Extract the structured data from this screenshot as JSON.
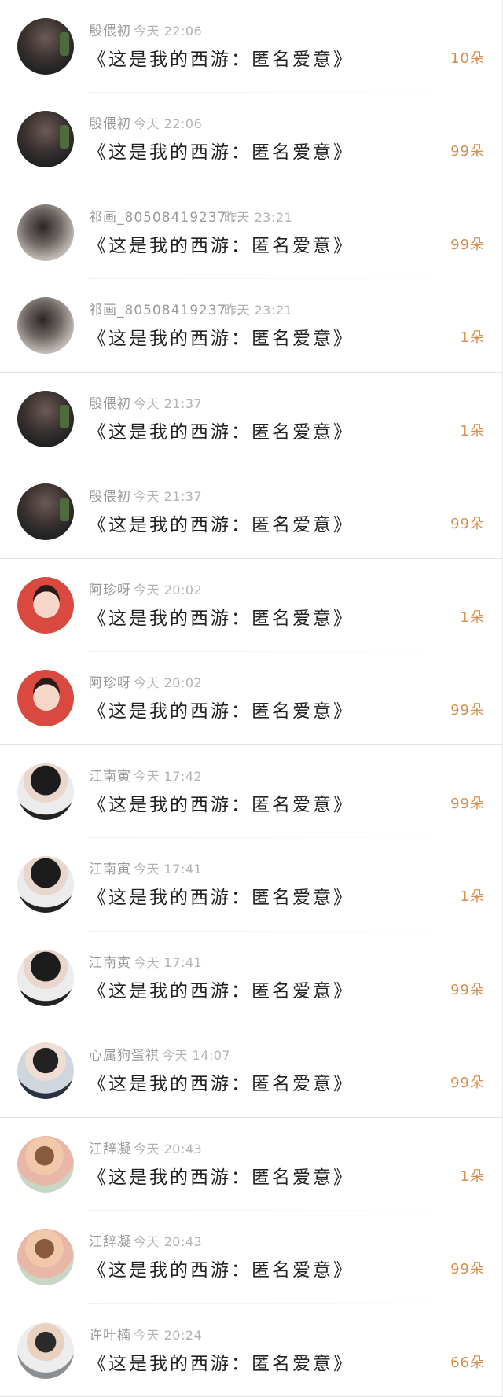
{
  "messages": [
    {
      "name": "殷偎初",
      "time": "今天 22:06",
      "title": "《这是我的西游：匿名爱意》",
      "count": "10朵",
      "avatar": "dark-avatar"
    },
    {
      "name": "殷偎初",
      "time": "今天 22:06",
      "title": "《这是我的西游：匿名爱意》",
      "count": "99朵",
      "avatar": "dark-avatar"
    },
    {
      "name": "祁画_80508419237...",
      "time": "昨天 23:21",
      "title": "《这是我的西游：匿名爱意》",
      "count": "99朵",
      "avatar": "gray-avatar"
    },
    {
      "name": "祁画_80508419237...",
      "time": "昨天 23:21",
      "title": "《这是我的西游：匿名爱意》",
      "count": "1朵",
      "avatar": "gray-avatar"
    },
    {
      "name": "殷偎初",
      "time": "今天 21:37",
      "title": "《这是我的西游：匿名爱意》",
      "count": "1朵",
      "avatar": "dark-avatar"
    },
    {
      "name": "殷偎初",
      "time": "今天 21:37",
      "title": "《这是我的西游：匿名爱意》",
      "count": "99朵",
      "avatar": "dark-avatar"
    },
    {
      "name": "阿珍呀",
      "time": "今天 20:02",
      "title": "《这是我的西游：匿名爱意》",
      "count": "1朵",
      "avatar": "red-avatar"
    },
    {
      "name": "阿珍呀",
      "time": "今天 20:02",
      "title": "《这是我的西游：匿名爱意》",
      "count": "99朵",
      "avatar": "red-avatar"
    },
    {
      "name": "江南寅",
      "time": "今天 17:42",
      "title": "《这是我的西游：匿名爱意》",
      "count": "99朵",
      "avatar": "boy-avatar"
    },
    {
      "name": "江南寅",
      "time": "今天 17:41",
      "title": "《这是我的西游：匿名爱意》",
      "count": "1朵",
      "avatar": "boy-avatar"
    },
    {
      "name": "江南寅",
      "time": "今天 17:41",
      "title": "《这是我的西游：匿名爱意》",
      "count": "99朵",
      "avatar": "boy-avatar"
    },
    {
      "name": "心属狗蛋祺",
      "time": "今天 14:07",
      "title": "《这是我的西游：匿名爱意》",
      "count": "99朵",
      "avatar": "boy2-avatar"
    },
    {
      "name": "江辞凝",
      "time": "今天 20:43",
      "title": "《这是我的西游：匿名爱意》",
      "count": "1朵",
      "avatar": "girl-avatar"
    },
    {
      "name": "江辞凝",
      "time": "今天 20:43",
      "title": "《这是我的西游：匿名爱意》",
      "count": "99朵",
      "avatar": "girl-avatar"
    },
    {
      "name": "许叶楠",
      "time": "今天 20:24",
      "title": "《这是我的西游：匿名爱意》",
      "count": "66朵",
      "avatar": "kid-avatar"
    }
  ],
  "colors": {
    "count": "#d98e4d",
    "name": "#9a9a9a",
    "time": "#b3b3b3",
    "title": "#222222"
  }
}
